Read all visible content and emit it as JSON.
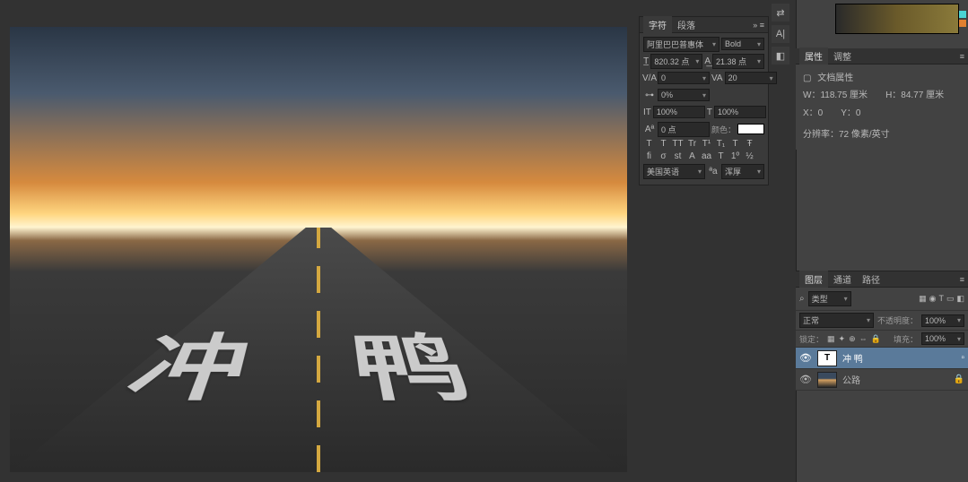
{
  "canvas": {
    "text": "冲 鸭"
  },
  "charPanel": {
    "tabs": {
      "char": "字符",
      "para": "段落"
    },
    "collapse": "»  ≡",
    "font": "阿里巴巴普惠体",
    "weight": "Bold",
    "size": "820.32 点",
    "leading": "21.38 点",
    "tracking": "0",
    "kerning": "20",
    "tracking2": "0%",
    "vscale": "100%",
    "hscale": "100%",
    "baseline": "0 点",
    "colorLabel": "颜色：",
    "lang": "美国英语",
    "aa": "浑厚",
    "btns1": [
      "T",
      "T",
      "TT",
      "Tr",
      "T¹",
      "T₁",
      "T",
      "Ŧ"
    ],
    "btns2": [
      "fi",
      "σ",
      "st",
      "A",
      "aa",
      "T",
      "1º",
      "½"
    ]
  },
  "sideIcons": [
    "⇄",
    "A|",
    "◧"
  ],
  "colorChips": [
    "#4ad4d4",
    "#e08030"
  ],
  "propsPanel": {
    "tabs": {
      "props": "属性",
      "adjust": "调整"
    },
    "title": "文档属性",
    "w": "W：118.75 厘米",
    "h": "H：84.77 厘米",
    "x": "X：0",
    "y": "Y：0",
    "res": "分辨率：72 像素/英寸"
  },
  "layersPanel": {
    "tabs": {
      "layers": "图层",
      "channels": "通道",
      "paths": "路径"
    },
    "kind": "类型",
    "blend": "正常",
    "opacity": "不透明度：",
    "opacityVal": "100%",
    "lock": "锁定：",
    "fill": "填充：",
    "fillVal": "100%",
    "lockIcons": [
      "▦",
      "✦",
      "⊕",
      "⇔",
      "🔒"
    ],
    "filterIcons": [
      "▦",
      "◉",
      "T",
      "▭",
      "◧"
    ],
    "layers": [
      {
        "name": "冲 鸭",
        "type": "text",
        "selected": true
      },
      {
        "name": "公路",
        "type": "image",
        "selected": false
      }
    ]
  }
}
